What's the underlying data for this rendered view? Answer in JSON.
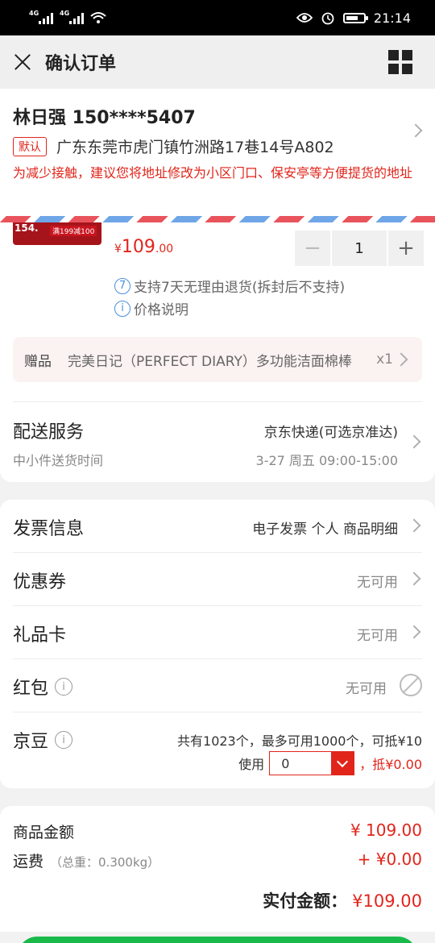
{
  "status": {
    "net1": "4G",
    "net2": "4G",
    "time": "21:14"
  },
  "header": {
    "title": "确认订单"
  },
  "address": {
    "name_phone": "林日强 150****5407",
    "default_tag": "默认",
    "detail": "广东东莞市虎门镇竹洲路17巷14号A802",
    "hint": "为减少接触，建议您将地址修改为小区门口、保安亭等方便提货的地址"
  },
  "product": {
    "img_badge": "154.",
    "img_promo": "满199减100",
    "currency": "¥",
    "price_int": "109",
    "price_dec": ".00",
    "qty": "1",
    "minus": "−",
    "plus": "+",
    "return_num": "7",
    "return_policy": "支持7天无理由退货(拆封后不支持)",
    "price_note": "价格说明"
  },
  "gift": {
    "label": "赠品",
    "name": "完美日记（PERFECT DIARY）多功能洁面棉棒",
    "count": "x1"
  },
  "shipping": {
    "title": "配送服务",
    "subtitle": "中小件送货时间",
    "carrier": "京东快递(可选京准达)",
    "time": "3-27 周五 09:00-15:00"
  },
  "options": {
    "invoice": {
      "label": "发票信息",
      "value": "电子发票 个人 商品明细"
    },
    "coupon": {
      "label": "优惠券",
      "value": "无可用"
    },
    "giftcard": {
      "label": "礼品卡",
      "value": "无可用"
    },
    "redpacket": {
      "label": "红包",
      "value": "无可用"
    },
    "beans": {
      "label": "京豆",
      "info": "共有1023个，最多可用1000个，可抵¥10",
      "use_label": "使用",
      "use_value": "0",
      "offset": "，抵¥0.00"
    }
  },
  "summary": {
    "goods_label": "商品金额",
    "goods_value": "¥ 109.00",
    "freight_label": "运费",
    "freight_weight": "（总重：0.300kg）",
    "freight_value": "+ ¥0.00",
    "total_label": "实付金额：",
    "total_value": "¥109.00"
  }
}
